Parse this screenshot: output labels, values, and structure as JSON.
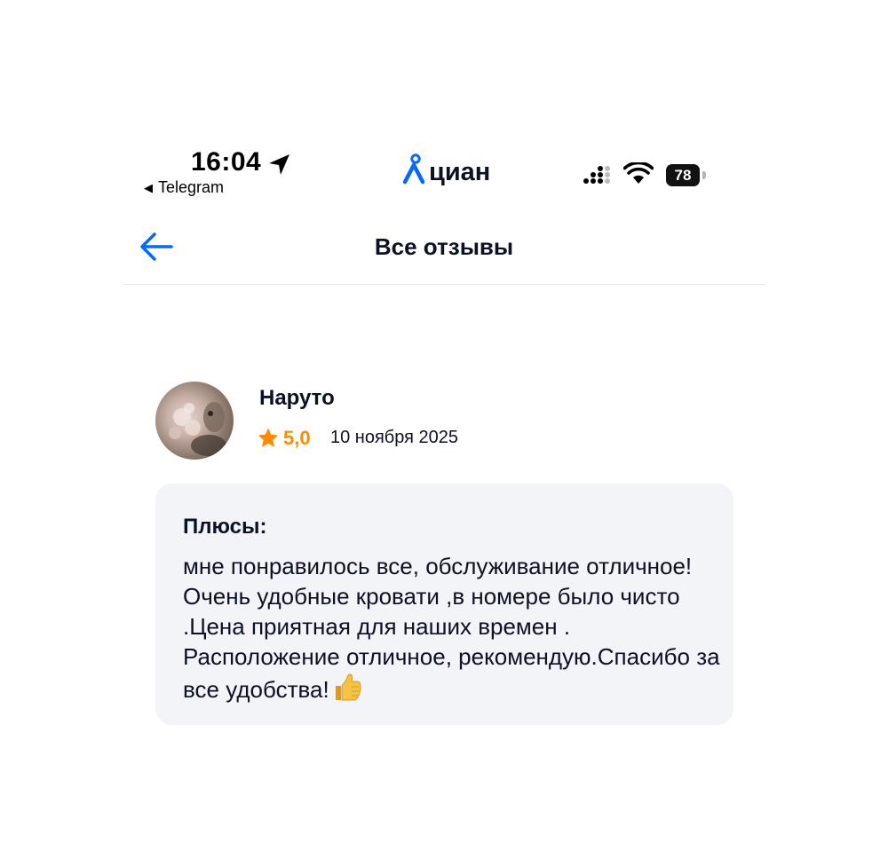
{
  "status_bar": {
    "time": "16:04",
    "back_app": "Telegram",
    "back_app_icon": "back-triangle-icon",
    "location_icon": "location-arrow-icon",
    "signal_icon": "cellular-signal-icon",
    "wifi_icon": "wifi-icon",
    "battery_level": "78"
  },
  "app": {
    "brand": "циан",
    "brand_icon": "cian-pin-logo",
    "brand_color": "#0468ff"
  },
  "header": {
    "title": "Все отзывы",
    "back_icon": "arrow-left-icon"
  },
  "review": {
    "author": "Наруто",
    "rating": "5,0",
    "rating_icon": "star-icon",
    "rating_color": "#ff8c00",
    "date": "10 ноября 2025",
    "pros_title": "Плюсы:",
    "pros_text": "мне понравилось все, обслуживание отличное!Очень удобные кровати ,в номере было чисто .Цена приятная для наших времен . Расположение отличное, рекомендую.Спасибо за все удобства!",
    "emoji_icon": "thumbs-up-icon"
  }
}
